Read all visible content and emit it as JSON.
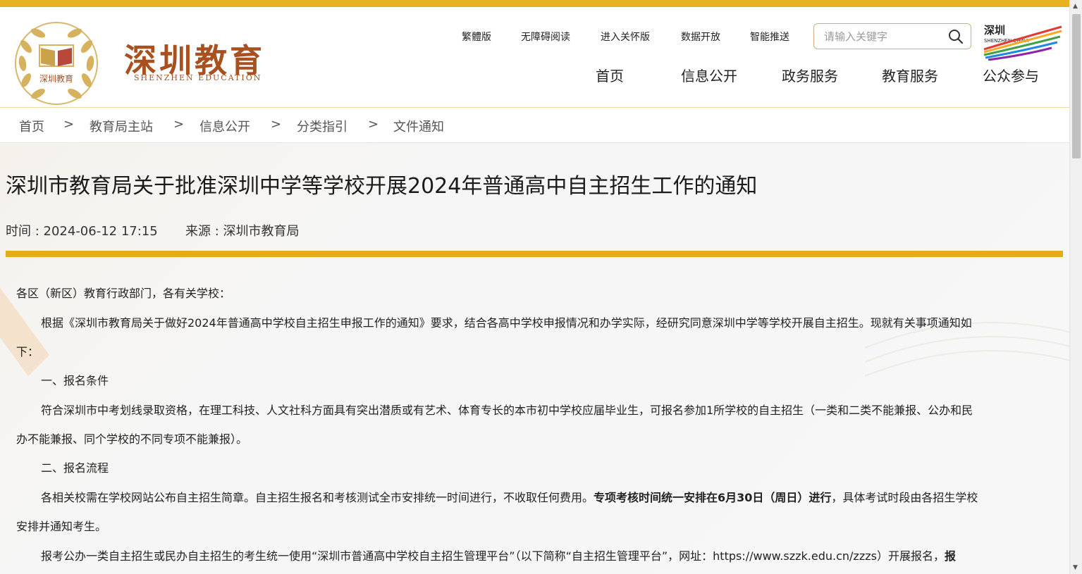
{
  "header": {
    "logo_title": "深圳教育",
    "logo_subtitle": "SHENZHEN EDUCATION",
    "emblem_text": "深圳教育",
    "utility_links": [
      "繁體版",
      "无障碍阅读",
      "进入关怀版",
      "数据开放",
      "智能推送"
    ],
    "search_placeholder": "请输入关键字",
    "china_logo_text_cn": "深圳",
    "china_logo_text_en": "SHENZHEN CHINA",
    "nav": [
      "首页",
      "信息公开",
      "政务服务",
      "教育服务",
      "公众参与"
    ]
  },
  "breadcrumb": {
    "items": [
      "首页",
      "教育局主站",
      "信息公开",
      "分类指引",
      "文件通知"
    ],
    "separator": ">"
  },
  "article": {
    "title": "深圳市教育局关于批准深圳中学等学校开展2024年普通高中自主招生工作的通知",
    "time_label": "时间 : 2024-06-12 17:15",
    "source_label": "来源 : 深圳市教育局",
    "salutation": "各区（新区）教育行政部门，各有关学校：",
    "p1_line1": "根据《深圳市教育局关于做好2024年普通高中学校自主招生申报工作的通知》要求，结合各高中学校申报情况和办学实际，经研究同意深圳中学等学校开展自主招生。现就有关事项通知如",
    "p1_line2": "下：",
    "h1": "一、报名条件",
    "p2_line1": "符合深圳市中考划线录取资格，在理工科技、人文社科方面具有突出潜质或有艺术、体育专长的本市初中学校应届毕业生，可报名参加1所学校的自主招生（一类和二类不能兼报、公办和民",
    "p2_line2": "办不能兼报、同个学校的不同专项不能兼报）。",
    "h2": "二、报名流程",
    "p3_line1_a": "各相关校需在学校网站公布自主招生简章。自主招生报名和考核测试全市安排统一时间进行，不收取任何费用。",
    "p3_line1_bold": "专项考核时间统一安排在6月30日（周日）进行",
    "p3_line1_b": "，具体考试时段由各招生学校",
    "p3_line2": "安排并通知考生。",
    "p4_line1_a": "报考公办一类自主招生或民办自主招生的考生统一使用“深圳市普通高中学校自主招生管理平台”（以下简称“自主招生管理平台”，网址：https://www.szzk.edu.cn/zzzs）开展报名，",
    "p4_line1_bold": "报"
  },
  "colors": {
    "gold": "#e4ad17",
    "brand_red": "#a8501f"
  }
}
